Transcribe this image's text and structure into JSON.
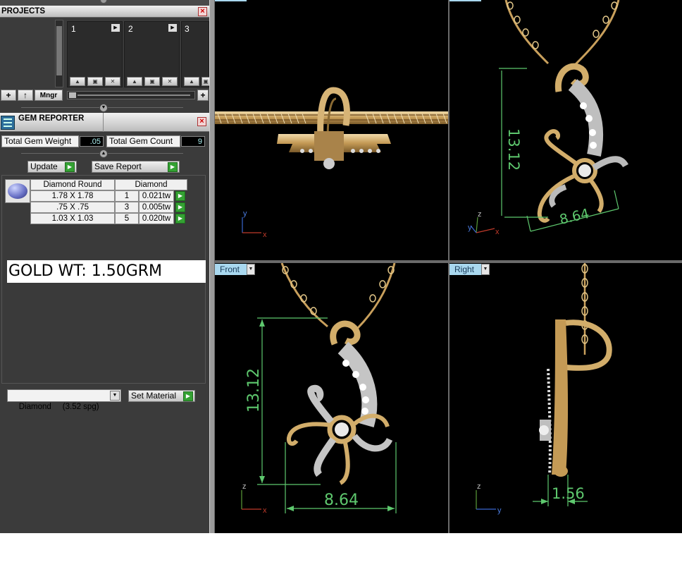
{
  "projects_panel": {
    "title": "PROJECTS",
    "slots": [
      {
        "label": "1"
      },
      {
        "label": "2"
      },
      {
        "label": "3"
      }
    ],
    "manager_label": "Mngr"
  },
  "gem_reporter": {
    "title": "GEM REPORTER",
    "total_weight_label": "Total Gem Weight",
    "total_weight_value": ".05",
    "total_count_label": "Total Gem Count",
    "total_count_value": "9",
    "update_label": "Update",
    "save_report_label": "Save Report",
    "table": {
      "headers": [
        "Diamond Round",
        "Diamond"
      ],
      "rows": [
        {
          "size": "1.78 X 1.78",
          "count": "1",
          "weight": "0.021tw"
        },
        {
          "size": ".75 X .75",
          "count": "3",
          "weight": "0.005tw"
        },
        {
          "size": "1.03 X 1.03",
          "count": "5",
          "weight": "0.020tw"
        }
      ]
    },
    "gold_weight": "GOLD WT: 1.50GRM",
    "material_select": "Diamond     (3.52 spg)",
    "set_material_label": "Set Material"
  },
  "viewports": {
    "front_label": "Front",
    "right_label": "Right",
    "dims": {
      "persp_height": "13.12",
      "persp_width": "8.64",
      "front_height": "13.12",
      "front_width": "8.64",
      "right_depth": "1.56"
    },
    "axes": {
      "y": "y",
      "x": "x",
      "z": "z"
    }
  },
  "colors": {
    "panel_bg": "#3b3b3b",
    "viewport_bg": "#000000",
    "viewport_label_bg": "#a9d8ef",
    "dimension_color": "#5ec86e",
    "gold": "#c9a05c",
    "accent_green": "#34a233"
  }
}
